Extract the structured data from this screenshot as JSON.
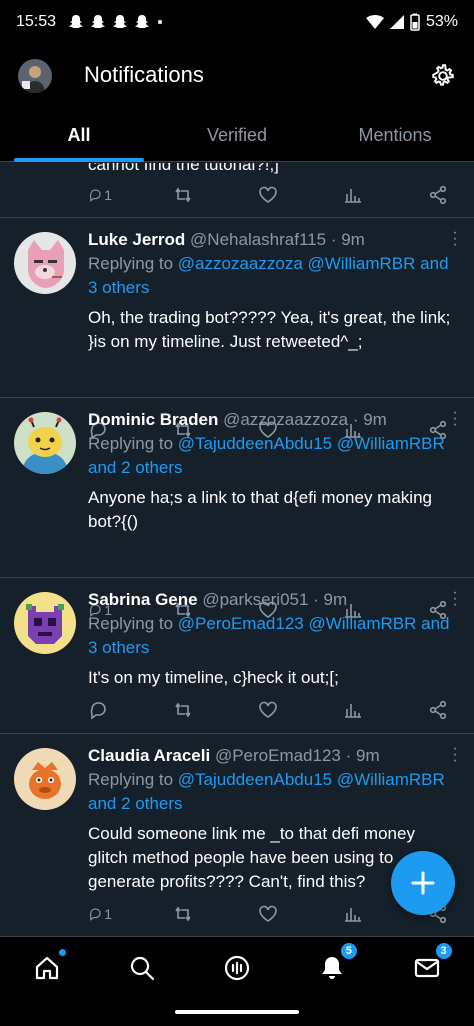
{
  "status_bar": {
    "time": "15:53",
    "battery": "53%"
  },
  "app_bar": {
    "title": "Notifications"
  },
  "tabs": [
    {
      "label": "All",
      "active": true
    },
    {
      "label": "Verified",
      "active": false
    },
    {
      "label": "Mentions",
      "active": false
    }
  ],
  "partial_tweet": {
    "text": "cannot find the tutorial?!;]",
    "reply_count": "1"
  },
  "tweets": [
    {
      "name": "Luke Jerrod",
      "handle": "@Nehalashraf115",
      "time": "· 9m",
      "replying_to": "Replying to",
      "mentions": "@azzozaazzoza @WilliamRBR",
      "others": "and 3 others",
      "text": "Oh, the trading bot????? Yea, it's great, the link; }is on my timeline. Just retweeted^_;",
      "reply_count": ""
    },
    {
      "name": "Dominic Braden",
      "handle": "@azzozaazzoza",
      "time": "· 9m",
      "replying_to": "Replying to",
      "mentions": "@TajuddeenAbdu15 @WilliamRBR",
      "others": "and 2 others",
      "text": "Anyone ha;s a link to that d{efi money making bot?{()",
      "reply_count": "1"
    },
    {
      "name": "Sabrina Gene",
      "handle": "@parkseri051",
      "time": "· 9m",
      "replying_to": "Replying to",
      "mentions": "@PeroEmad123 @WilliamRBR",
      "others": "and 3 others",
      "text": "It's on my timeline, c}heck it out;[;",
      "reply_count": ""
    },
    {
      "name": "Claudia Araceli",
      "handle": "@PeroEmad123",
      "time": "· 9m",
      "replying_to": "Replying to",
      "mentions": "@TajuddeenAbdu15 @WilliamRBR",
      "others": "and 2 others",
      "text": "Could someone link me _to that defi money glitch method people have been using to generate profits???? Can't, find this?",
      "reply_count": "1"
    }
  ],
  "bottom_nav": {
    "notifications_badge": "5",
    "messages_badge": "3"
  },
  "colors": {
    "accent": "#1d9bf0",
    "background": "#15202b",
    "muted": "#8b98a5"
  },
  "icons": [
    "home-icon",
    "search-icon",
    "spaces-icon",
    "bell-icon",
    "mail-icon",
    "gear-icon",
    "plus-icon"
  ]
}
